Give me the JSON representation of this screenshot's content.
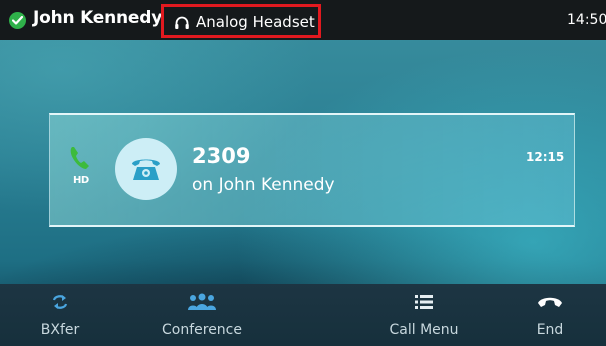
{
  "header": {
    "user_name": "John Kennedy",
    "audio_device": "Analog Headset",
    "time": "14:50"
  },
  "call": {
    "hd_label": "HD",
    "number": "2309",
    "line": "on John Kennedy",
    "duration": "12:15"
  },
  "softkeys": [
    {
      "label": "BXfer",
      "icon": "transfer-arrows-icon"
    },
    {
      "label": "Conference",
      "icon": "conference-people-icon"
    },
    {
      "label": "Call Menu",
      "icon": "menu-list-icon"
    },
    {
      "label": "End",
      "icon": "end-call-icon"
    }
  ],
  "colors": {
    "status_green": "#2fb14a",
    "highlight_red": "#e1191f",
    "call_green": "#3dbb3d",
    "header_bg": "#15191b"
  }
}
